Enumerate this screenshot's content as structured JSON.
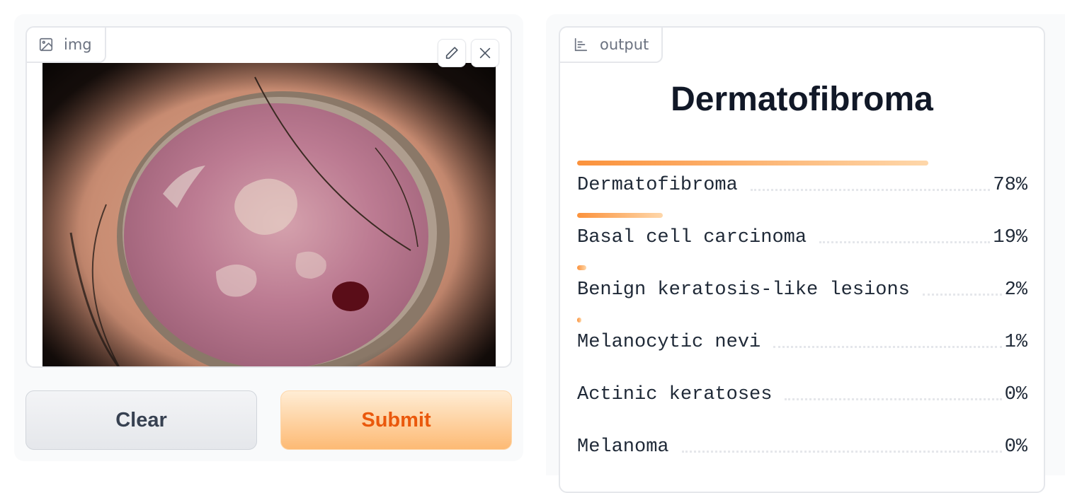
{
  "input": {
    "label": "img",
    "label_icon": "image-icon",
    "edit_icon": "pencil-icon",
    "clear_icon": "close-icon"
  },
  "buttons": {
    "clear": "Clear",
    "submit": "Submit"
  },
  "output": {
    "label": "output",
    "label_icon": "bar-chart-icon",
    "top_label": "Dermatofibroma",
    "confidences": [
      {
        "label": "Dermatofibroma",
        "percent": "78%",
        "value": 0.78
      },
      {
        "label": "Basal cell carcinoma",
        "percent": "19%",
        "value": 0.19
      },
      {
        "label": "Benign keratosis-like lesions",
        "percent": "2%",
        "value": 0.02
      },
      {
        "label": "Melanocytic nevi",
        "percent": "1%",
        "value": 0.01
      },
      {
        "label": "Actinic keratoses",
        "percent": "0%",
        "value": 0.0
      },
      {
        "label": "Melanoma",
        "percent": "0%",
        "value": 0.0
      }
    ]
  },
  "colors": {
    "accent": "#f97316",
    "submit_text": "#ea580c",
    "bar_start": "#fb923c",
    "bar_end": "#fed7aa"
  }
}
